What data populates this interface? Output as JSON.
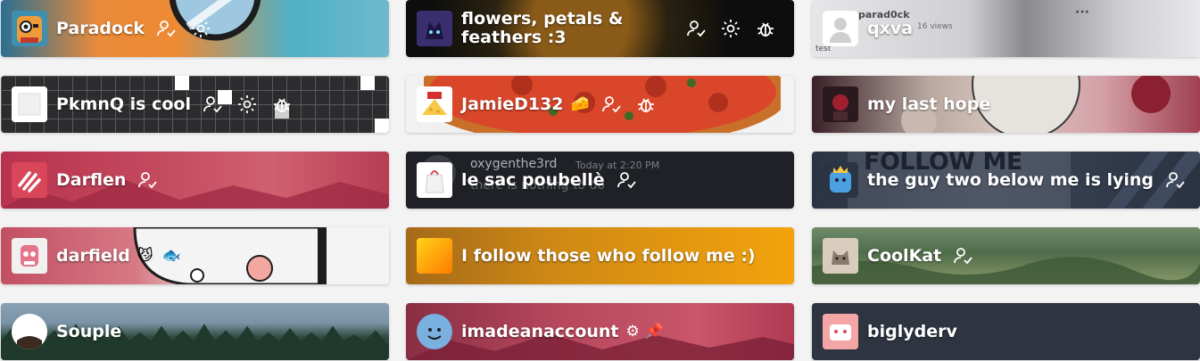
{
  "cards": [
    {
      "id": "paradock",
      "name": "Paradock",
      "icons": [
        "user-check-icon",
        "gear-icon"
      ]
    },
    {
      "id": "flowers",
      "name": "flowers, petals & feathers :3",
      "icons": [
        "user-check-icon",
        "gear-icon",
        "bug-icon"
      ]
    },
    {
      "id": "qxva",
      "name": "qxva",
      "icons": [],
      "background_text": {
        "author": "parad0ck",
        "views": "16 views",
        "caption": "test",
        "menu": "···"
      }
    },
    {
      "id": "pkmnq",
      "name": "PkmnQ is cool",
      "icons": [
        "user-check-icon",
        "gear-icon",
        "bug-icon"
      ]
    },
    {
      "id": "jamied132",
      "name": "JamieD132",
      "badge_emoji": "🧀",
      "icons": [
        "user-check-icon",
        "bug-icon"
      ]
    },
    {
      "id": "my-last-hope",
      "name": "my last hope",
      "icons": []
    },
    {
      "id": "darflen",
      "name": "Darflen",
      "icons": [
        "user-check-icon"
      ]
    },
    {
      "id": "le-sac-poubelle",
      "name": "le sac poubellè",
      "icons": [
        "user-check-icon"
      ],
      "background_text": {
        "author": "oxygenthe3rd",
        "timestamp": "Today at 2:20 PM",
        "message": "there is nothing to do"
      }
    },
    {
      "id": "the-guy-two-below",
      "name": "the guy two below me is lying",
      "icons": [
        "user-check-icon"
      ],
      "background_text": {
        "banner": "FOLLOW ME"
      }
    },
    {
      "id": "darfield",
      "name": "darfield",
      "emojis": [
        "😼",
        "🐟"
      ],
      "icons": []
    },
    {
      "id": "i-follow",
      "name": "I follow those who follow me :)",
      "icons": []
    },
    {
      "id": "coolkat",
      "name": "CoolKat",
      "icons": [
        "user-check-icon"
      ]
    },
    {
      "id": "souple",
      "name": "Souple",
      "icons": []
    },
    {
      "id": "imadeanaccount",
      "name": "imadeanaccount",
      "emojis": [
        "⚙",
        "📌"
      ],
      "icons": []
    },
    {
      "id": "biglyderv",
      "name": "biglyderv",
      "icons": []
    }
  ],
  "colors": {
    "name_text": "#ffffff",
    "page_background": "#f3f3f4"
  }
}
